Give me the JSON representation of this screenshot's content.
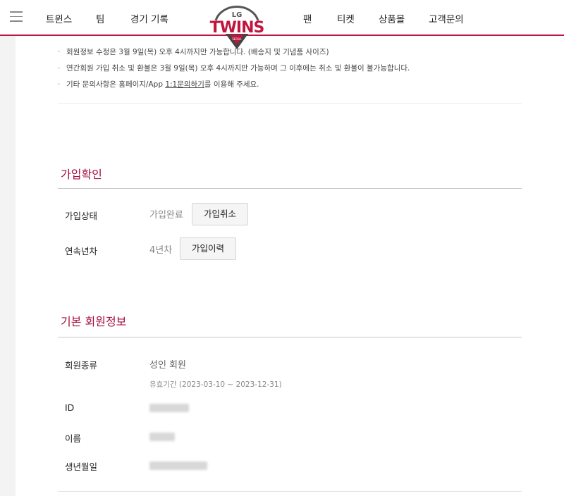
{
  "header": {
    "nav_left": [
      "트윈스",
      "팀",
      "경기 기록"
    ],
    "nav_right": [
      "팬",
      "티켓",
      "상품몰",
      "고객문의"
    ],
    "logo": {
      "top": "LG",
      "main": "TWINS",
      "sub": "SEOUL"
    },
    "brand_color": "#c1153e"
  },
  "notices": [
    {
      "text": "회원정보 수정은 3월 9일(목) 오후 4시까지만 가능합니다. (배송지 및 기념품 사이즈)"
    },
    {
      "text": "연간회원 가입 취소 및 환불은 3월 9일(목) 오후 4시까지만 가능하며 그 이후에는 취소 및 환불이 불가능합니다."
    },
    {
      "prefix": "기타 문의사항은 홈페이지/App ",
      "link": "1:1문의하기",
      "suffix": "를 이용해 주세요."
    }
  ],
  "join_confirm": {
    "title": "가입확인",
    "status_label": "가입상태",
    "status_value": "가입완료",
    "cancel_button": "가입취소",
    "years_label": "연속년차",
    "years_value": "4년차",
    "history_button": "가입이력"
  },
  "basic_info": {
    "title": "기본 회원정보",
    "type_label": "회원종류",
    "type_value": "성인 회원",
    "validity": "유효기간 (2023-03-10 ~ 2023-12-31)",
    "id_label": "ID",
    "name_label": "이름",
    "birth_label": "생년월일"
  }
}
